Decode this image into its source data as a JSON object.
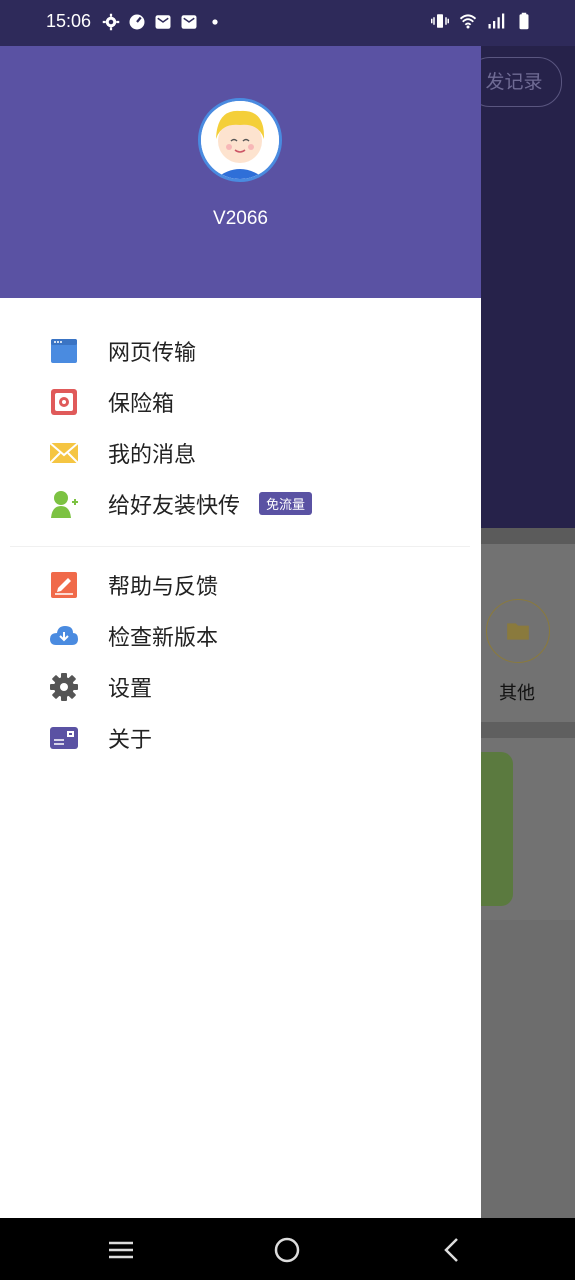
{
  "status_bar": {
    "time": "15:06",
    "left_icons": [
      "gear-icon",
      "speedometer-icon",
      "mail-icon",
      "mail-icon",
      "dot-icon"
    ],
    "right_icons": [
      "vibrate-icon",
      "wifi-icon",
      "signal-icon",
      "battery-icon"
    ]
  },
  "background_app": {
    "record_button_label": "发记录",
    "other_label": "其他"
  },
  "drawer": {
    "username": "V2066",
    "menu_group_1": [
      {
        "label": "网页传输",
        "icon": "browser-window-icon",
        "color": "#4a8be0"
      },
      {
        "label": "保险箱",
        "icon": "safe-icon",
        "color": "#e05a5a"
      },
      {
        "label": "我的消息",
        "icon": "envelope-icon",
        "color": "#f5c542"
      },
      {
        "label": "给好友装快传",
        "icon": "add-friend-icon",
        "color": "#7cc242",
        "badge": "免流量"
      }
    ],
    "menu_group_2": [
      {
        "label": "帮助与反馈",
        "icon": "pencil-icon",
        "color": "#f06a4a"
      },
      {
        "label": "检查新版本",
        "icon": "cloud-download-icon",
        "color": "#4a8be0"
      },
      {
        "label": "设置",
        "icon": "gear-icon",
        "color": "#555555"
      },
      {
        "label": "关于",
        "icon": "id-card-icon",
        "color": "#5a52a3"
      }
    ]
  },
  "nav_bar": {
    "buttons": [
      "menu-icon",
      "home-circle-icon",
      "back-icon"
    ]
  }
}
